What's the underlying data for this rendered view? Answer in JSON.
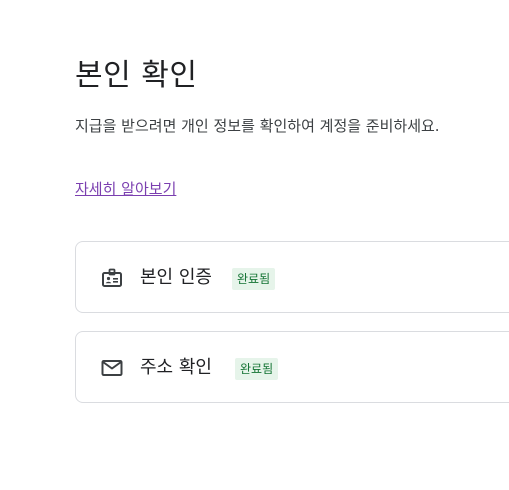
{
  "page": {
    "title": "본인 확인",
    "description": "지급을 받으려면 개인 정보를 확인하여 계정을 준비하세요.",
    "learn_more": "자세히 알아보기"
  },
  "cards": [
    {
      "icon": "id-badge-icon",
      "label": "본인 인증",
      "status": "완료됨"
    },
    {
      "icon": "mail-icon",
      "label": "주소 확인",
      "status": "완료됨"
    }
  ],
  "colors": {
    "link": "#7b3fb0",
    "badge_background": "#e6f4ea",
    "badge_text": "#137333",
    "card_border": "#dadce0"
  }
}
